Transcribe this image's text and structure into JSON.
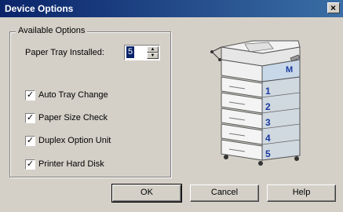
{
  "window": {
    "title": "Device Options",
    "close_glyph": "×"
  },
  "group": {
    "legend": "Available Options",
    "tray_label": "Paper Tray Installed:",
    "tray_value": "5"
  },
  "options": [
    {
      "label": "Auto Tray Change",
      "checked": true
    },
    {
      "label": "Paper Size Check",
      "checked": true
    },
    {
      "label": "Duplex Option Unit",
      "checked": true
    },
    {
      "label": "Printer Hard Disk",
      "checked": true
    }
  ],
  "check_glyph": "✓",
  "buttons": {
    "ok": "OK",
    "cancel": "Cancel",
    "help": "Help"
  },
  "printer": {
    "badge": "M",
    "tray_numbers": [
      "1",
      "2",
      "3",
      "4",
      "5"
    ]
  }
}
